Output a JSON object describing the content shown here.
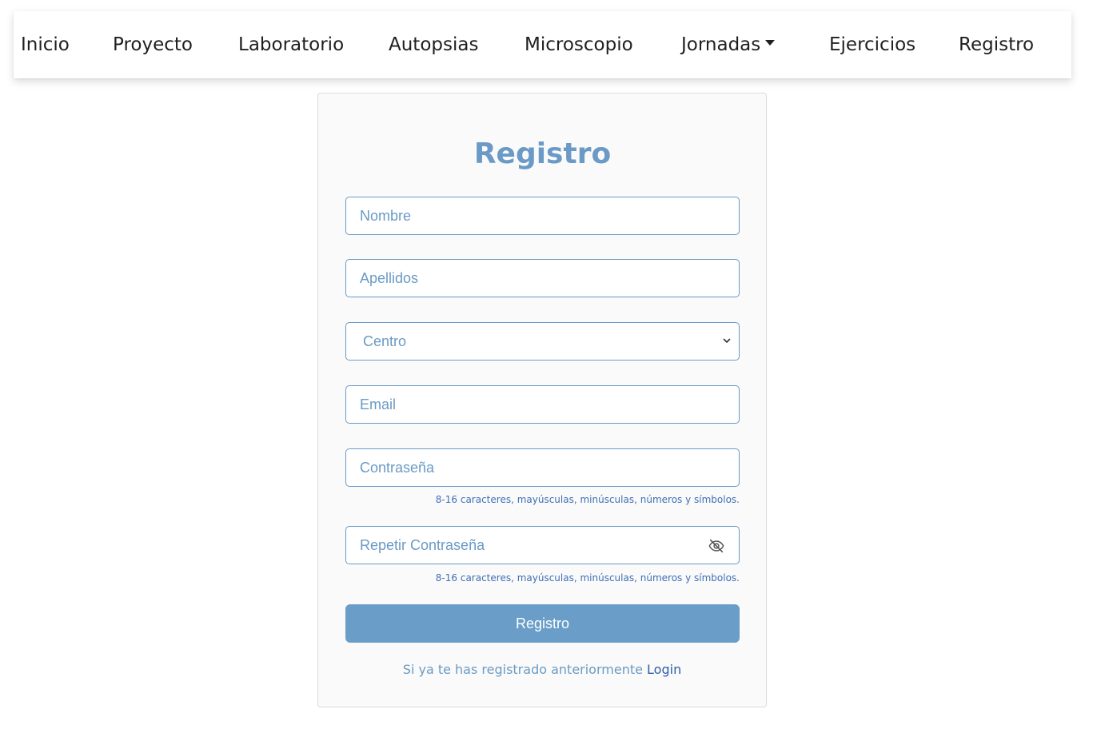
{
  "nav": {
    "items": [
      {
        "label": "Inicio"
      },
      {
        "label": "Proyecto"
      },
      {
        "label": "Laboratorio"
      },
      {
        "label": "Autopsias"
      },
      {
        "label": "Microscopio"
      },
      {
        "label": "Jornadas",
        "has_dropdown": true
      },
      {
        "label": "Ejercicios"
      },
      {
        "label": "Registro"
      }
    ]
  },
  "form": {
    "title": "Registro",
    "fields": {
      "nombre": {
        "placeholder": "Nombre",
        "value": ""
      },
      "apellidos": {
        "placeholder": "Apellidos",
        "value": ""
      },
      "centro": {
        "selected": "Centro"
      },
      "email": {
        "placeholder": "Email",
        "value": ""
      },
      "password": {
        "placeholder": "Contraseña",
        "value": ""
      },
      "repeat_password": {
        "placeholder": "Repetir Contraseña",
        "value": ""
      }
    },
    "password_hint": "8-16 caracteres, mayúsculas, minúsculas, números y símbolos.",
    "repeat_password_hint": "8-16 caracteres, mayúsculas, minúsculas, números y símbolos.",
    "submit_label": "Registro",
    "login_prompt": "Si ya te has registrado anteriormente",
    "login_link": "Login"
  },
  "icons": {
    "dropdown": "caret-down-icon",
    "select": "chevron-down-icon",
    "toggle_visibility": "eye-slash-icon"
  },
  "colors": {
    "accent": "#6a9ac5",
    "button": "#6a9ec8",
    "hint": "#3f6fb6",
    "link": "#2f5ea8"
  }
}
